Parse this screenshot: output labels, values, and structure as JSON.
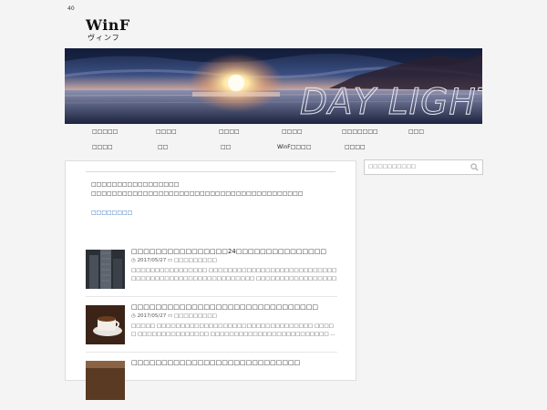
{
  "count": "40",
  "logo": {
    "main": "WinF",
    "sub": "ヴィンフ"
  },
  "banner": {
    "text": "DAY LIGHT"
  },
  "nav": {
    "row1": [
      "□□□□□",
      "□□□□",
      "□□□□",
      "□□□□",
      "□□□□□□□",
      "□□□"
    ],
    "row2": [
      "□□□□",
      "□□",
      "□□",
      "WinF□□□□",
      "□□□□"
    ]
  },
  "intro": {
    "line1": "□□□□□□□□□□□□□□□□□",
    "line2": "□□□□□□□□□□□□□□□□□□□□□□□□□□□□□□□□□□□□□□□□□",
    "link": "□□□□□□□□"
  },
  "posts": [
    {
      "title": "□□□□□□□□□□□□□□□□24□□□□□□□□□□□□□□□",
      "date": "2017/05/27",
      "category": "□□□□□□□□□",
      "excerpt": "□□□□□□□□□□□□□□□□ □□□□□□□□□□□□□□□□□□□□□□□□□□□□□□□□□□□□□□□□□□□□□□□□□□□□□ □□□□□□□□□□□□□□□□□□ ..."
    },
    {
      "title": "□□□□□□□□□□□□□□□□□□□□□□□□□□□□□□□",
      "date": "2017/05/27",
      "category": "□□□□□□□□□",
      "excerpt": "□□□□□ □□□□□□□□□□□□□□□□□□□□□□□□□□□□□□□□□ □□□□□ □□□□□□□□□□□□□□□ □□□□□□□□□□□□□□□□□□□□□□□□□ ..."
    },
    {
      "title": "□□□□□□□□□□□□□□□□□□□□□□□□□□□□",
      "date": "",
      "category": "",
      "excerpt": ""
    }
  ],
  "search": {
    "placeholder": "□□□□□□□□□□"
  },
  "colors": {
    "link": "#2a6ab0",
    "rule": "#e2d9c8"
  },
  "icons": {
    "clock": "clock-icon",
    "folder": "folder-icon",
    "search": "search-icon"
  }
}
